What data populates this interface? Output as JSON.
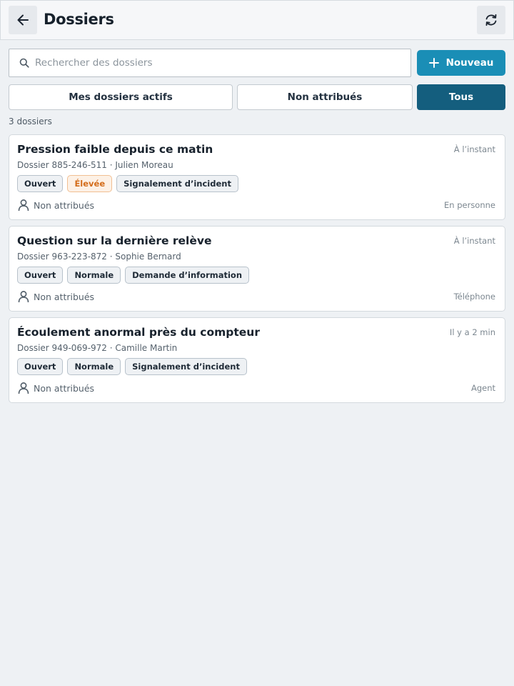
{
  "header": {
    "title": "Dossiers",
    "back_icon": "arrow-left-icon",
    "refresh_icon": "refresh-icon"
  },
  "search": {
    "placeholder": "Rechercher des dossiers",
    "value": ""
  },
  "new_button": {
    "label": "Nouveau",
    "icon": "plus-icon"
  },
  "filters": [
    {
      "label": "Mes dossiers actifs",
      "active": false
    },
    {
      "label": "Non attribués",
      "active": false
    },
    {
      "label": "Tous",
      "active": true
    }
  ],
  "count": "3 dossiers",
  "colors": {
    "accent": "#1a8eb6",
    "active_filter": "#145e7e",
    "priority_high": "#d46d1b",
    "background": "#eef1f4"
  },
  "cases": [
    {
      "title": "Pression faible depuis ce matin",
      "time": "À l’instant",
      "meta": "Dossier 885-246-511 · Julien Moreau",
      "tags": [
        {
          "label": "Ouvert"
        },
        {
          "label": "Élevée"
        },
        {
          "label": "Signalement d’incident"
        }
      ],
      "assignee": "Non attribués",
      "channel": "En personne"
    },
    {
      "title": "Question sur la dernière relève",
      "time": "À l’instant",
      "meta": "Dossier 963-223-872 · Sophie Bernard",
      "tags": [
        {
          "label": "Ouvert"
        },
        {
          "label": "Normale"
        },
        {
          "label": "Demande d’information"
        }
      ],
      "assignee": "Non attribués",
      "channel": "Téléphone"
    },
    {
      "title": "Écoulement anormal près du compteur",
      "time": "Il y a 2 min",
      "meta": "Dossier 949-069-972 · Camille Martin",
      "tags": [
        {
          "label": "Ouvert"
        },
        {
          "label": "Normale"
        },
        {
          "label": "Signalement d’incident"
        }
      ],
      "assignee": "Non attribués",
      "channel": "Agent"
    }
  ]
}
